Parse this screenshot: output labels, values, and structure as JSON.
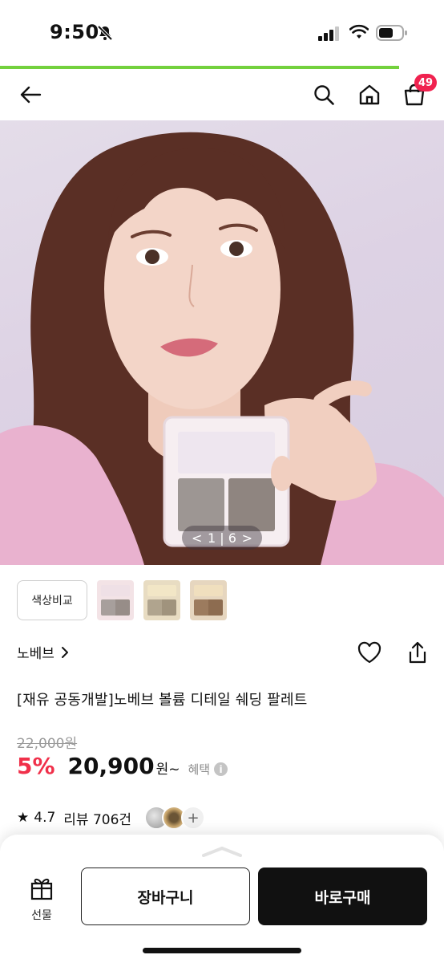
{
  "status_bar": {
    "time": "9:50"
  },
  "header": {
    "cart_count": "49"
  },
  "gallery": {
    "prev": "<",
    "current": "1",
    "separator": "|",
    "total": "6",
    "next": ">"
  },
  "colors": {
    "compare_label": "색상비교"
  },
  "product": {
    "brand": "노베브",
    "title": "[재유 공동개발]노베브 볼륨 디테일 쉐딩 팔레트",
    "original_price": "22,000원",
    "discount": "5%",
    "price": "20,900",
    "currency": "원~",
    "benefit_label": "혜택",
    "info_icon": "i",
    "rating_star": "★",
    "rating": "4.7",
    "reviews": "리뷰 706건",
    "more": "+"
  },
  "bottom_bar": {
    "gift_label": "선물",
    "cart_button": "장바구니",
    "buy_button": "바로구매"
  },
  "theme": {
    "accent": "#73d13d",
    "badge": "#f0224f",
    "discount": "#f0304a"
  }
}
